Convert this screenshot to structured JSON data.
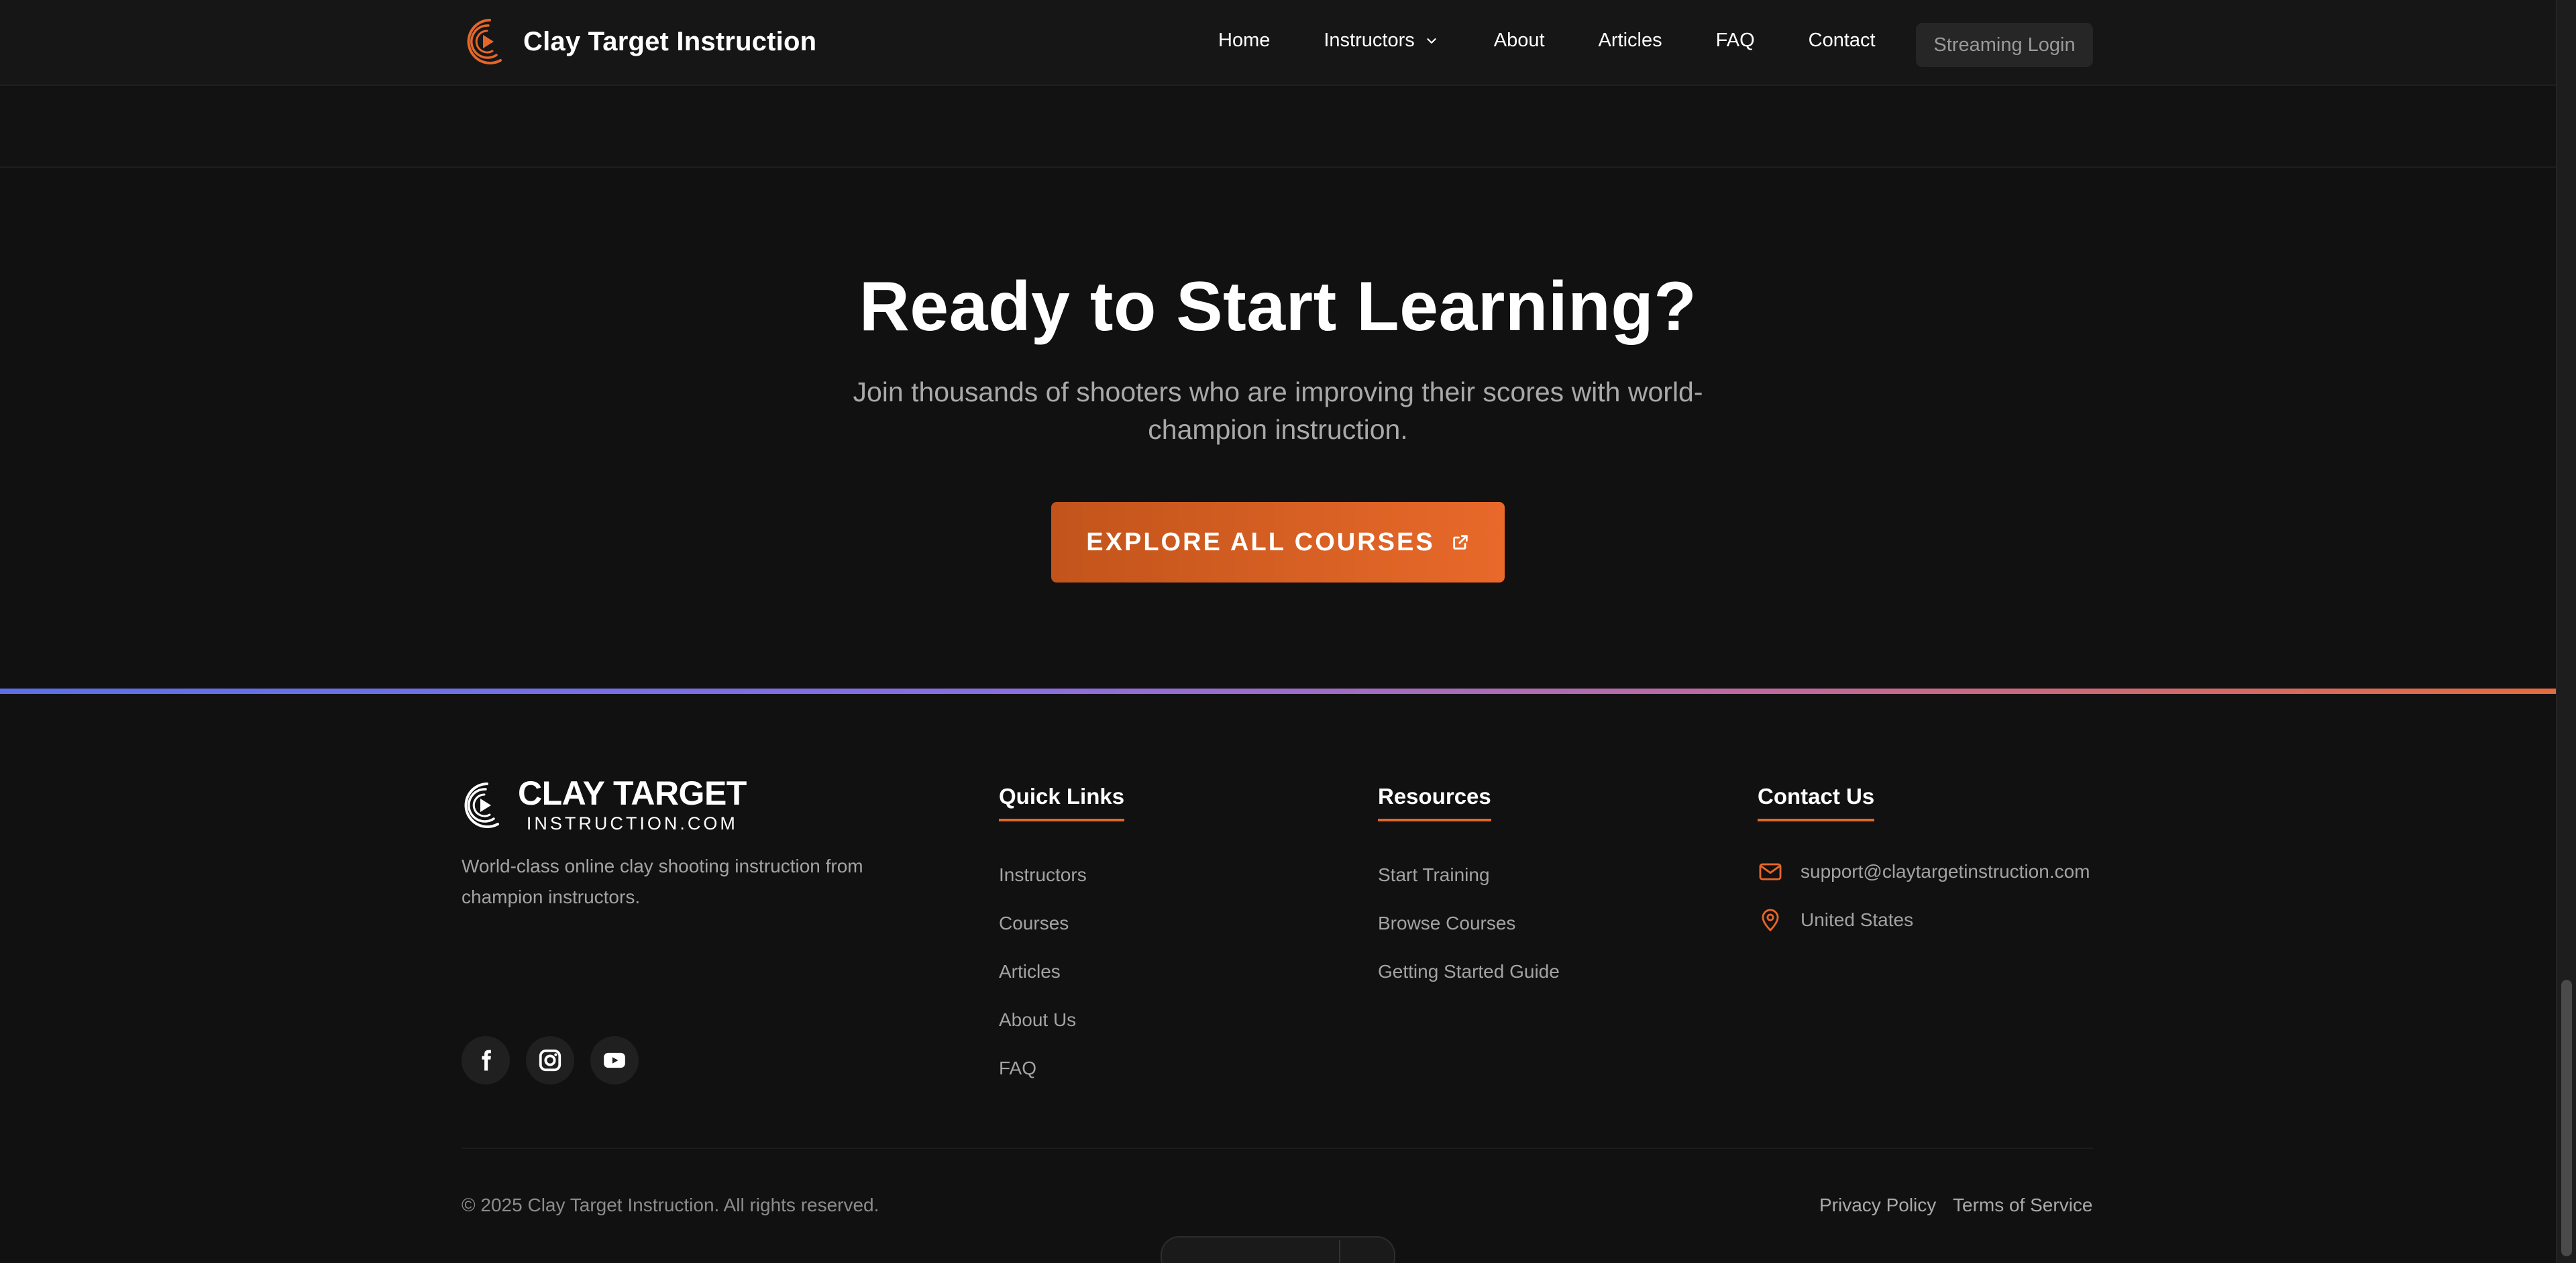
{
  "header": {
    "brand": "Clay Target Instruction",
    "nav": {
      "home": "Home",
      "instructors": "Instructors",
      "about": "About",
      "articles": "Articles",
      "faq": "FAQ",
      "contact": "Contact"
    },
    "login": "Streaming Login"
  },
  "cta": {
    "title": "Ready to Start Learning?",
    "subtitle": "Join thousands of shooters who are improving their scores with world-champion instruction.",
    "button": "EXPLORE ALL COURSES"
  },
  "footer": {
    "brand_main": "CLAY TARGET",
    "brand_sub": "INSTRUCTION.COM",
    "description": "World-class online clay shooting instruction from champion instructors.",
    "socials": [
      "facebook-icon",
      "instagram-icon",
      "youtube-icon"
    ],
    "quick_links": {
      "heading": "Quick Links",
      "items": [
        "Instructors",
        "Courses",
        "Articles",
        "About Us",
        "FAQ"
      ]
    },
    "resources": {
      "heading": "Resources",
      "items": [
        "Start Training",
        "Browse Courses",
        "Getting Started Guide"
      ]
    },
    "contact": {
      "heading": "Contact Us",
      "email": "support@claytargetinstruction.com",
      "location": "United States"
    },
    "copyright": "© 2025 Clay Target Instruction. All rights reserved.",
    "privacy": "Privacy Policy",
    "terms": "Terms of Service"
  },
  "colors": {
    "accent": "#e3672b",
    "background": "#111111",
    "muted_text": "#a3a3a3"
  }
}
